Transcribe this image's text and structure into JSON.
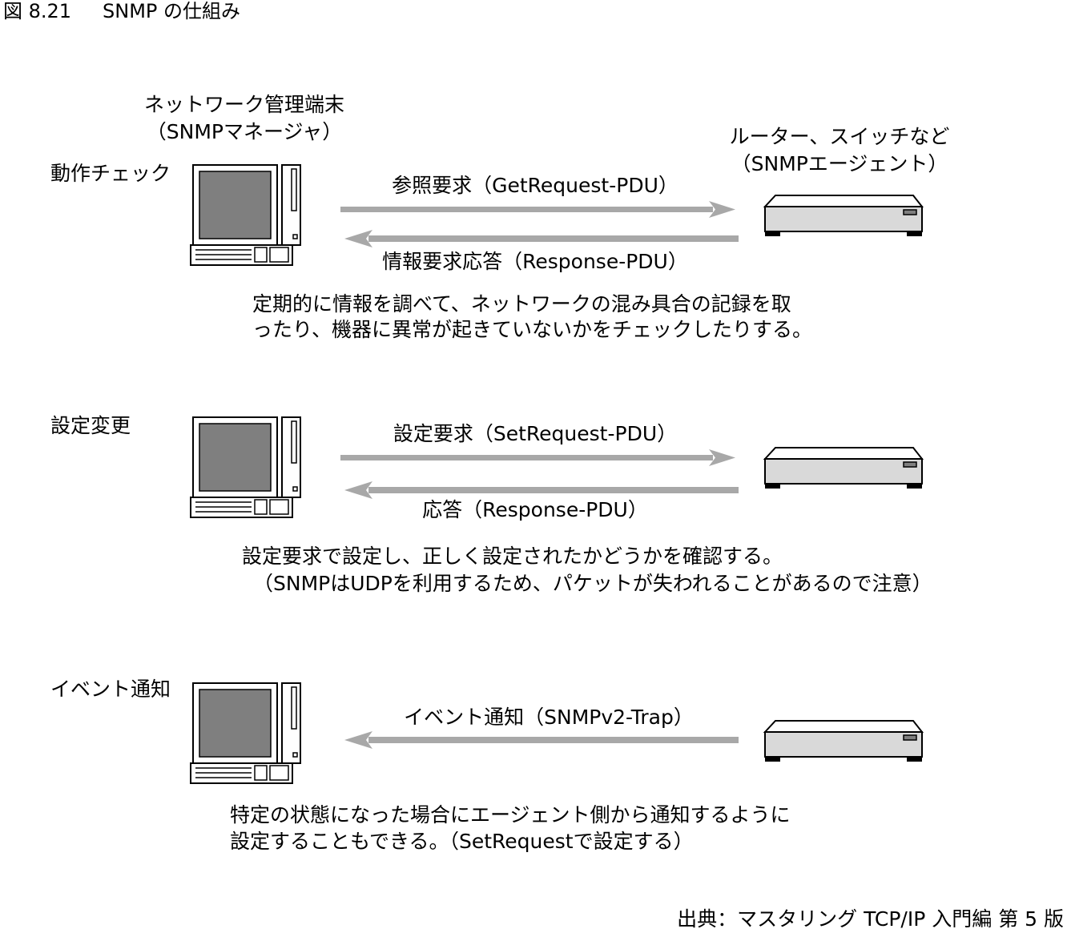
{
  "figure": {
    "number": "図 8.21",
    "title": "SNMP の仕組み"
  },
  "manager": {
    "line1": "ネットワーク管理端末",
    "line2": "（SNMPマネージャ）"
  },
  "agent": {
    "line1": "ルーター、スイッチなど",
    "line2": "（SNMPエージェント）"
  },
  "sections": [
    {
      "label": "動作チェック",
      "request": "参照要求（GetRequest-PDU）",
      "response": "情報要求応答（Response-PDU）",
      "description": [
        "定期的に情報を調べて、ネットワークの混み具合の記録を取",
        "ったり、機器に異常が起きていないかをチェックしたりする。"
      ]
    },
    {
      "label": "設定変更",
      "request": "設定要求（SetRequest-PDU）",
      "response": "応答（Response-PDU）",
      "description": [
        "設定要求で設定し、正しく設定されたかどうかを確認する。",
        "（SNMPはUDPを利用するため、パケットが失われることがあるので注意）"
      ]
    },
    {
      "label": "イベント通知",
      "notification": "イベント通知（SNMPv2-Trap）",
      "description": [
        "特定の状態になった場合にエージェント側から通知するように",
        "設定することもできる。（SetRequestで設定する）"
      ]
    }
  ],
  "source": "出典：マスタリング TCP/IP 入門編 第 5 版",
  "colors": {
    "arrow": "#a8a8a8",
    "device_fill": "#d9d9d9",
    "screen_fill": "#7f7f7f",
    "outline": "#000000"
  }
}
